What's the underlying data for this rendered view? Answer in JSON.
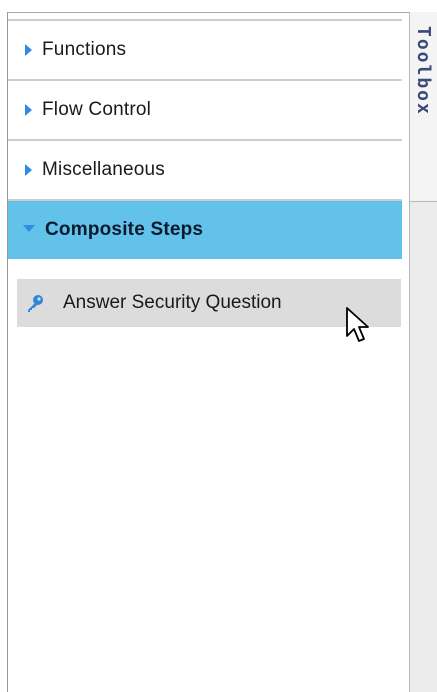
{
  "toolbox": {
    "tab_label": "Toolbox",
    "categories": [
      {
        "label": "Functions",
        "expanded": false
      },
      {
        "label": "Flow Control",
        "expanded": false
      },
      {
        "label": "Miscellaneous",
        "expanded": false
      },
      {
        "label": "Composite Steps",
        "expanded": true
      }
    ],
    "composite_steps": [
      {
        "label": "Answer Security Question",
        "icon": "key-icon"
      }
    ]
  },
  "colors": {
    "expanded_header": "#62c2ea",
    "arrow": "#2d8de0",
    "hover_item": "#dcdcdc",
    "tab_text": "#3b4a78"
  }
}
